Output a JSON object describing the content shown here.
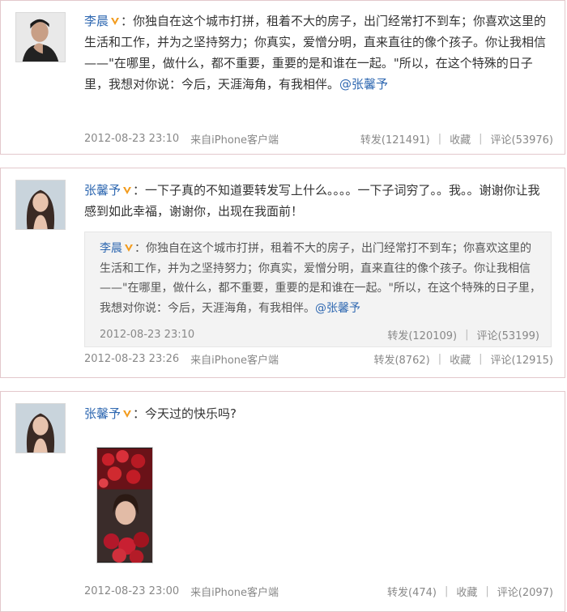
{
  "posts": [
    {
      "author": "李晨",
      "text": "：你独自在这个城市打拼，租着不大的房子，出门经常打不到车；你喜欢这里的生活和工作，并为之坚持努力；你真实，爱憎分明，直来直往的像个孩子。你让我相信——\"在哪里，做什么，都不重要，重要的是和谁在一起。\"所以，在这个特殊的日子里，我想对你说：今后，天涯海角，有我相伴。",
      "mention": "@张馨予",
      "time": "2012-08-23 23:10",
      "source": "来自iPhone客户端",
      "repost": "转发(121491)",
      "fav": "收藏",
      "comment": "评论(53976)"
    },
    {
      "author": "张馨予",
      "text": "：一下子真的不知道要转发写上什么。。。。一下子词穷了。。我。。谢谢你让我感到如此幸福，谢谢你，出现在我面前！",
      "quoted": {
        "author": "李晨",
        "text": "：你独自在这个城市打拼，租着不大的房子，出门经常打不到车；你喜欢这里的生活和工作，并为之坚持努力；你真实，爱憎分明，直来直往的像个孩子。你让我相信——\"在哪里，做什么，都不重要，重要的是和谁在一起。\"所以，在这个特殊的日子里，我想对你说：今后，天涯海角，有我相伴。",
        "mention": "@张馨予",
        "time": "2012-08-23 23:10",
        "repost": "转发(120109)",
        "comment": "评论(53199)"
      },
      "time": "2012-08-23 23:26",
      "source": "来自iPhone客户端",
      "repost": "转发(8762)",
      "fav": "收藏",
      "comment": "评论(12915)"
    },
    {
      "author": "张馨予",
      "text": "：今天过的快乐吗?",
      "time": "2012-08-23 23:00",
      "source": "来自iPhone客户端",
      "repost": "转发(474)",
      "fav": "收藏",
      "comment": "评论(2097)"
    }
  ],
  "icons": {
    "verified_badge": "verified-v-icon",
    "avatar_male": "avatar-li-chen",
    "avatar_female": "avatar-zhang-xinyu"
  },
  "colors": {
    "name": "#2f68b1",
    "verified": "#f29b1d",
    "border": "#e3c8cc",
    "meta": "#888888"
  }
}
